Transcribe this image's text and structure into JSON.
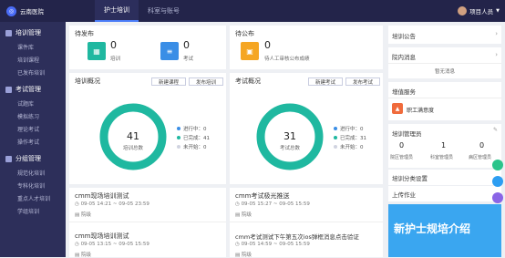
{
  "header": {
    "logo_text": "云南医院",
    "tabs": [
      {
        "label": "护士培训",
        "active": true
      },
      {
        "label": "科室与账号",
        "active": false
      }
    ],
    "user": "项目人员"
  },
  "sidebar": {
    "groups": [
      {
        "label": "培训管理",
        "items": [
          "课件库",
          "培训课程",
          "已发布培训"
        ]
      },
      {
        "label": "考试管理",
        "items": [
          "试题库",
          "模拟练习",
          "理论考试",
          "操作考试"
        ]
      },
      {
        "label": "分组管理",
        "items": [
          "规范化培训",
          "专科化培训",
          "重点人才培训",
          "学组培训"
        ]
      }
    ]
  },
  "pending_publish": {
    "title": "待发布",
    "items": [
      {
        "icon": "training-icon",
        "count": "0",
        "label": "培训",
        "color": "#1fb8a0"
      },
      {
        "icon": "exam-icon",
        "count": "0",
        "label": "考试",
        "color": "#3a8ee6"
      }
    ]
  },
  "pending_announce": {
    "title": "待公布",
    "items": [
      {
        "icon": "grade-icon",
        "count": "0",
        "label": "待人工审核公布成绩",
        "color": "#f5a623"
      }
    ]
  },
  "training_overview": {
    "title": "培训概况",
    "btn_new": "新建课程",
    "btn_publish": "发布培训",
    "total": "41",
    "total_label": "培训总数",
    "legend": [
      {
        "label": "进行中：0",
        "color": "#3a8ee6"
      },
      {
        "label": "已完成：41",
        "color": "#1fb8a0"
      },
      {
        "label": "未开始：0",
        "color": "#d0d3e0"
      }
    ],
    "list": [
      {
        "title": "cmm现场培训测试",
        "time": "09-05 14:21 ~ 09-05 23:59",
        "tag": "院级"
      },
      {
        "title": "cmm现场培训测试",
        "time": "09-05 13:15 ~ 09-05 15:59",
        "tag": "院级"
      }
    ]
  },
  "exam_overview": {
    "title": "考试概况",
    "btn_new": "新建考试",
    "btn_publish": "发布考试",
    "total": "31",
    "total_label": "考试总数",
    "legend": [
      {
        "label": "进行中：0",
        "color": "#3a8ee6"
      },
      {
        "label": "已完成：31",
        "color": "#1fb8a0"
      },
      {
        "label": "未开始：0",
        "color": "#d0d3e0"
      }
    ],
    "list": [
      {
        "title": "cmm考试极光推送",
        "time": "09-05 15:27 ~ 09-05 15:59",
        "tag": "院级"
      },
      {
        "title": "cmm考试测试下午第五次ios弹框消息点击验证",
        "time": "09-05 14:59 ~ 09-05 15:59",
        "tag": "院级"
      }
    ]
  },
  "right": {
    "announce_title": "培训公告",
    "news_title": "院内消息",
    "news_empty": "暂无消息",
    "value_title": "增值服务",
    "value_item": "职工满意度",
    "admin_title": "培训管理员",
    "admin_stats": [
      {
        "value": "0",
        "label": "院区管理员"
      },
      {
        "value": "1",
        "label": "科室管理员"
      },
      {
        "value": "0",
        "label": "病区管理员"
      }
    ],
    "setting_label": "培训分类设置",
    "upload_label": "上传作业",
    "banner_text": "新护士规培介绍"
  }
}
